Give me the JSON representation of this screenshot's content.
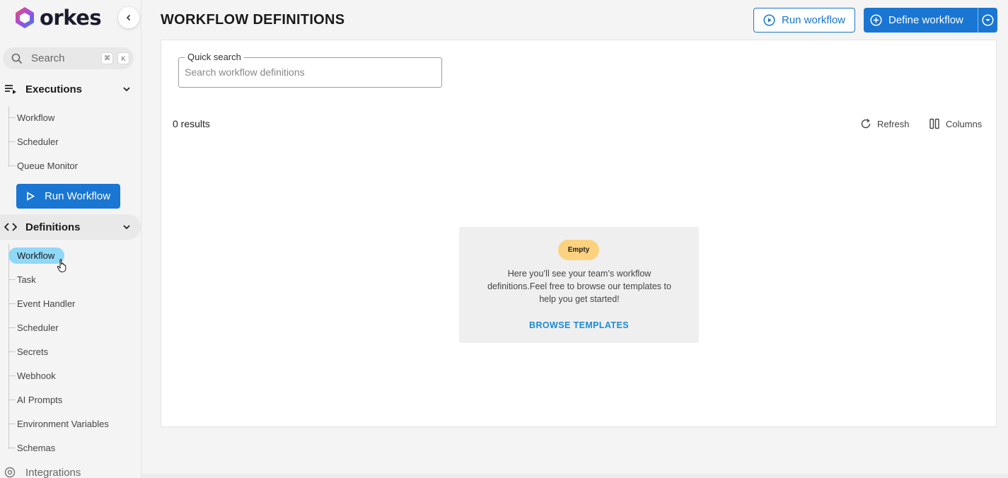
{
  "app": {
    "name": "orkes"
  },
  "sidebar": {
    "search": {
      "placeholder": "Search",
      "shortcut": [
        "⌘",
        "K"
      ]
    },
    "executions": {
      "label": "Executions",
      "items": [
        "Workflow",
        "Scheduler",
        "Queue Monitor"
      ]
    },
    "run_workflow_button": "Run Workflow",
    "definitions": {
      "label": "Definitions",
      "items": [
        "Workflow",
        "Task",
        "Event Handler",
        "Scheduler",
        "Secrets",
        "Webhook",
        "AI Prompts",
        "Environment Variables",
        "Schemas"
      ],
      "selected": "Workflow"
    },
    "integrations": {
      "label": "Integrations"
    }
  },
  "header": {
    "title": "WORKFLOW DEFINITIONS",
    "run_workflow": "Run workflow",
    "define_workflow": "Define workflow"
  },
  "main": {
    "quick_search": {
      "legend": "Quick search",
      "placeholder": "Search workflow definitions",
      "value": ""
    },
    "results": "0 results",
    "refresh": "Refresh",
    "columns": "Columns",
    "empty": {
      "badge": "Empty",
      "message": "Here you’ll see your team’s workflow definitions.Feel free to browse our templates to help you get started!",
      "link": "BROWSE TEMPLATES"
    }
  },
  "colors": {
    "primary": "#1976d2",
    "selected_nav": "#8fd8f7",
    "badge": "#fcd27e",
    "link": "#1b8bd6"
  }
}
